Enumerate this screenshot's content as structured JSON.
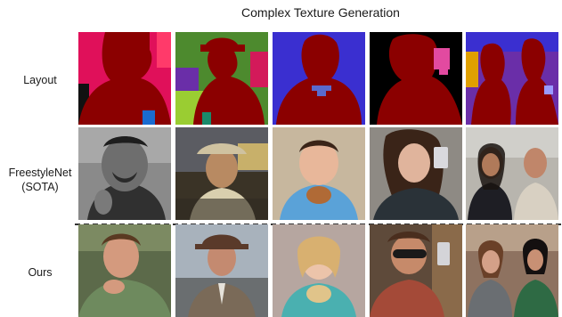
{
  "figure": {
    "title": "Complex Texture Generation",
    "rows": [
      {
        "label": "Layout",
        "kind": "layout"
      },
      {
        "label": "FreestyleNet\n(SOTA)",
        "kind": "photo"
      },
      {
        "label": "Ours",
        "kind": "photo"
      }
    ],
    "columns": 5
  },
  "colors": {
    "layout_person": "#8b0000",
    "layout_bg_1": "#e0105a",
    "layout_bg_2": "#4d8a2e",
    "layout_bg_3": "#3a2fd0",
    "layout_bg_4": "#000000",
    "layout_bg_5": "#6a2ea8",
    "divider": "#333333"
  }
}
